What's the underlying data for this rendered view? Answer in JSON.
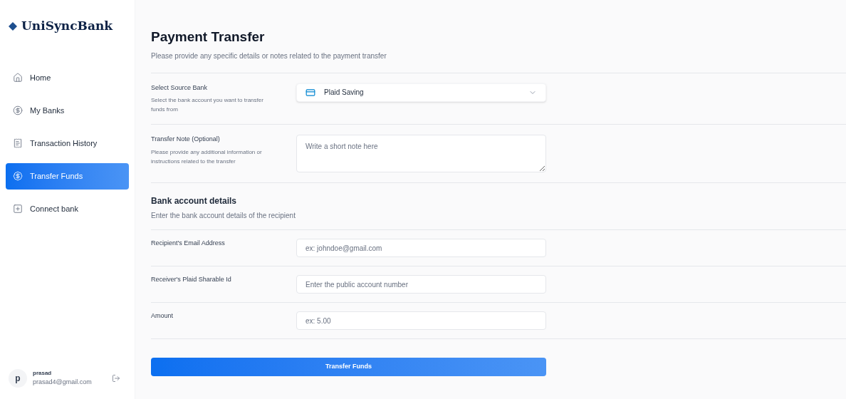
{
  "sidebar": {
    "logo": "UniSyncBank",
    "items": [
      {
        "label": "Home",
        "kind": "home",
        "selected": false
      },
      {
        "label": "My Banks",
        "kind": "dollar",
        "selected": false
      },
      {
        "label": "Transaction History",
        "kind": "receipt",
        "selected": false
      },
      {
        "label": "Transfer Funds",
        "kind": "transfer",
        "selected": true
      },
      {
        "label": "Connect bank",
        "kind": "connect",
        "selected": false
      }
    ],
    "user": {
      "avatar": "p",
      "name": "prasad",
      "email": "prasad4@gmail.com"
    }
  },
  "header": {
    "title": "Payment Transfer",
    "subtitle": "Please provide any specific details or notes related to the payment transfer"
  },
  "source_fields": [
    {
      "kind": "select",
      "label": "Select Source Bank",
      "description": "Select the bank account you want to transfer funds from",
      "value": "Plaid Saving"
    },
    {
      "kind": "textarea",
      "label": "Transfer Note (Optional)",
      "description": "Please provide any additional information or instructions related to the transfer",
      "placeholder": "Write a short note here"
    }
  ],
  "bank_section": {
    "title": "Bank account details",
    "subtitle": "Enter the bank account details of the recipient"
  },
  "recipient_fields": [
    {
      "kind": "input",
      "label": "Recipient's Email Address",
      "placeholder": "ex: johndoe@gmail.com"
    },
    {
      "kind": "input",
      "label": "Receiver's Plaid Sharable Id",
      "placeholder": "Enter the public account number"
    },
    {
      "kind": "input",
      "label": "Amount",
      "placeholder": "ex: 5.00"
    }
  ],
  "submit": "Transfer Funds"
}
